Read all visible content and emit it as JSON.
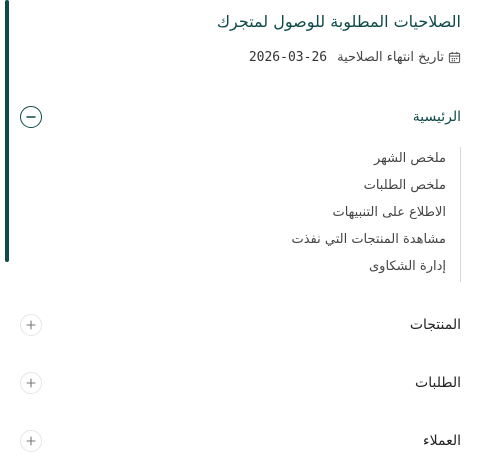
{
  "header": {
    "title": "الصلاحيات المطلوبة للوصول لمتجرك",
    "expiry_label": "تاريخ انتهاء الصلاحية",
    "expiry_date": "2026-03-26"
  },
  "sections": [
    {
      "label": "الرئيسية",
      "expanded": true,
      "items": [
        "ملخص الشهر",
        "ملخص الطلبات",
        "الاطلاع على التنبيهات",
        "مشاهدة المنتجات التي نفذت",
        "إدارة الشكاوى"
      ]
    },
    {
      "label": "المنتجات",
      "expanded": false
    },
    {
      "label": "الطلبات",
      "expanded": false
    },
    {
      "label": "العملاء",
      "expanded": false
    }
  ],
  "colors": {
    "accent": "#0f4a4a",
    "text": "#222222",
    "muted": "#444444",
    "divider": "#d8d8d8"
  },
  "icons": {
    "expiry": "calendar-icon",
    "collapse": "minus-circle-icon",
    "expand": "plus-icon"
  }
}
